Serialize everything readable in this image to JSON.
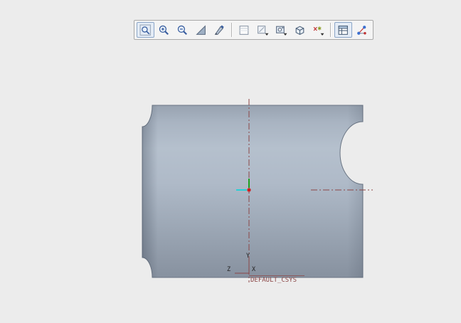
{
  "toolbar": {
    "buttons": [
      {
        "name": "zoom-region",
        "active": true
      },
      {
        "name": "zoom-in",
        "active": false
      },
      {
        "name": "zoom-out",
        "active": false
      },
      {
        "name": "refit",
        "active": false
      },
      {
        "name": "repaint",
        "active": false
      },
      {
        "name": "display-style",
        "active": false
      },
      {
        "name": "hidden-line-style",
        "active": false
      },
      {
        "name": "saved-views",
        "active": false
      },
      {
        "name": "view-orientation",
        "active": false
      },
      {
        "name": "datum-display",
        "active": false
      },
      {
        "name": "view-manager",
        "active": true
      },
      {
        "name": "datum-refs",
        "active": false
      }
    ]
  },
  "viewport": {
    "csys_label": "DEFAULT_CSYS",
    "axes": {
      "x": "X",
      "y": "Y",
      "z": "Z"
    },
    "colors": {
      "background": "#ececec",
      "centerline": "#8b4646",
      "model_light": "#b5c0cd",
      "model_dark": "#87919f",
      "origin_dot": "#cc2020",
      "x_axis_tick": "#29cfd6",
      "y_axis_tick": "#1fa01f"
    }
  }
}
